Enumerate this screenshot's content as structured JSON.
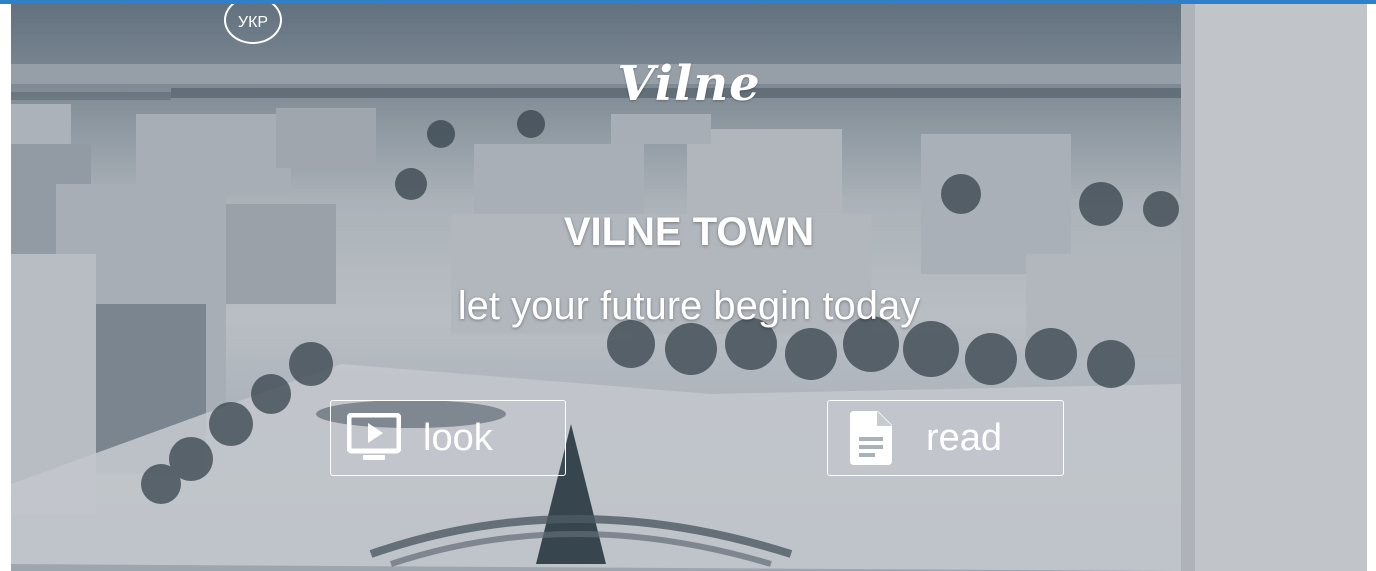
{
  "language": {
    "label": "УКР"
  },
  "brand": {
    "logo": "Vilne"
  },
  "hero": {
    "title": "VILNE TOWN",
    "tagline": "let your future begin today"
  },
  "actions": {
    "look": {
      "label": "look",
      "icon": "video-play-icon"
    },
    "read": {
      "label": "read",
      "icon": "document-icon"
    }
  },
  "colors": {
    "accent_line": "#2f7fc9",
    "text": "#ffffff"
  }
}
